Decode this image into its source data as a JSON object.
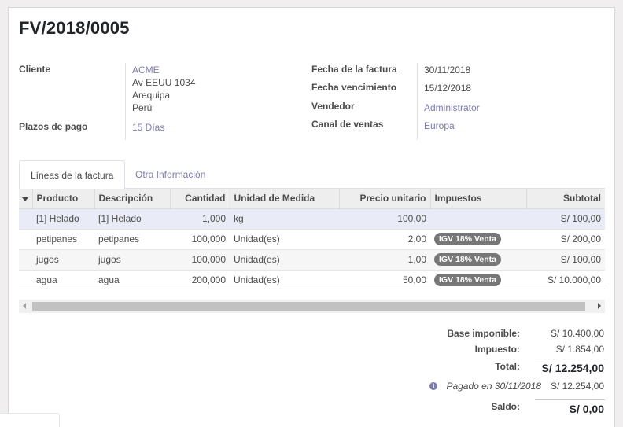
{
  "invoice": {
    "number": "FV/2018/0005",
    "customer_label": "Cliente",
    "customer_name": "ACME",
    "address_line1": "Av EEUU 1034",
    "address_line2": "Arequipa",
    "address_line3": "Perú",
    "payment_terms_label": "Plazos de pago",
    "payment_terms": "15 Días",
    "invoice_date_label": "Fecha de la factura",
    "invoice_date": "30/11/2018",
    "due_date_label": "Fecha vencimiento",
    "due_date": "15/12/2018",
    "salesperson_label": "Vendedor",
    "salesperson": "Administrator",
    "sales_channel_label": "Canal de ventas",
    "sales_channel": "Europa"
  },
  "tabs": [
    {
      "label": "Líneas de la factura",
      "active": true
    },
    {
      "label": "Otra Información",
      "active": false
    }
  ],
  "lines": {
    "headers": [
      "Producto",
      "Descripción",
      "Cantidad",
      "Unidad de Medida",
      "Precio unitario",
      "Impuestos",
      "Subtotal"
    ],
    "rows": [
      {
        "product": "[1] Helado",
        "description": "[1] Helado",
        "quantity": "1,000",
        "uom": "kg",
        "price": "100,00",
        "tax": "",
        "subtotal": "S/ 100,00"
      },
      {
        "product": "petipanes",
        "description": "petipanes",
        "quantity": "100,000",
        "uom": "Unidad(es)",
        "price": "2,00",
        "tax": "IGV 18% Venta",
        "subtotal": "S/ 200,00"
      },
      {
        "product": "jugos",
        "description": "jugos",
        "quantity": "100,000",
        "uom": "Unidad(es)",
        "price": "1,00",
        "tax": "IGV 18% Venta",
        "subtotal": "S/ 100,00"
      },
      {
        "product": "agua",
        "description": "agua",
        "quantity": "200,000",
        "uom": "Unidad(es)",
        "price": "50,00",
        "tax": "IGV 18% Venta",
        "subtotal": "S/ 10.000,00"
      }
    ]
  },
  "totals": {
    "base_label": "Base imponible:",
    "base_value": "S/ 10.400,00",
    "tax_label": "Impuesto:",
    "tax_value": "S/ 1.854,00",
    "total_label": "Total:",
    "total_value": "S/ 12.254,00",
    "paid_text": "Pagado en 30/11/2018",
    "paid_value": "S/ 12.254,00",
    "balance_label": "Saldo:",
    "balance_value": "S/ 0,00"
  },
  "icons": {
    "info": "info-circle-icon",
    "sort": "caret-down-icon",
    "scroll_left": "arrow-left-icon",
    "scroll_right": "arrow-right-icon"
  },
  "colors": {
    "link": "#7c7bad",
    "badge": "#777777",
    "selected_row": "#e9ecf6"
  }
}
